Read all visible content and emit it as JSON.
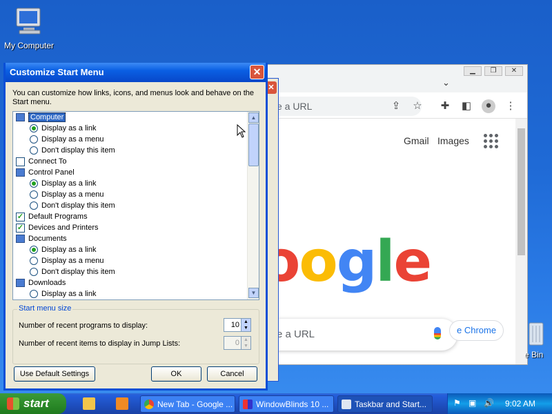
{
  "desktop": {
    "my_computer_label": "My Computer",
    "recycle_bin_label": "e Bin"
  },
  "chrome": {
    "omnibox_text": "e a URL",
    "gmail": "Gmail",
    "images": "Images",
    "logo_letters": [
      "o",
      "o",
      "g",
      "l",
      "e"
    ],
    "search_text": "e a URL",
    "customize_text": "e Chrome",
    "colors": {
      "blue": "#4285f4",
      "red": "#ea4335",
      "yellow": "#fbbc05",
      "green": "#34a853"
    }
  },
  "dialog": {
    "title": "Customize Start Menu",
    "description": "You can customize how links, icons, and menus look and behave on the Start menu.",
    "items": [
      {
        "type": "folder",
        "label": "Computer",
        "highlighted": true
      },
      {
        "type": "radio",
        "label": "Display as a link",
        "selected": true
      },
      {
        "type": "radio",
        "label": "Display as a menu",
        "selected": false
      },
      {
        "type": "radio",
        "label": "Don't display this item",
        "selected": false
      },
      {
        "type": "checkbox",
        "label": "Connect To",
        "checked": false
      },
      {
        "type": "folder",
        "label": "Control Panel"
      },
      {
        "type": "radio",
        "label": "Display as a link",
        "selected": true
      },
      {
        "type": "radio",
        "label": "Display as a menu",
        "selected": false
      },
      {
        "type": "radio",
        "label": "Don't display this item",
        "selected": false
      },
      {
        "type": "checkbox",
        "label": "Default Programs",
        "checked": true
      },
      {
        "type": "checkbox",
        "label": "Devices and Printers",
        "checked": true
      },
      {
        "type": "folder",
        "label": "Documents"
      },
      {
        "type": "radio",
        "label": "Display as a link",
        "selected": true
      },
      {
        "type": "radio",
        "label": "Display as a menu",
        "selected": false
      },
      {
        "type": "radio",
        "label": "Don't display this item",
        "selected": false
      },
      {
        "type": "folder",
        "label": "Downloads"
      },
      {
        "type": "radio",
        "label": "Display as a link",
        "selected": false
      }
    ],
    "group_label": "Start menu size",
    "recent_programs_label": "Number of recent programs to display:",
    "recent_programs_value": "10",
    "recent_items_label": "Number of recent items to display in Jump Lists:",
    "recent_items_value": "0",
    "default_button": "Use Default Settings",
    "ok_button": "OK",
    "cancel_button": "Cancel"
  },
  "taskbar": {
    "start_label": "start",
    "tasks": [
      {
        "label": "New Tab - Google ...",
        "active": false
      },
      {
        "label": "WindowBlinds 10 ...",
        "active": false
      },
      {
        "label": "Taskbar and Start...",
        "active": true
      }
    ],
    "clock": "9:02 AM"
  }
}
